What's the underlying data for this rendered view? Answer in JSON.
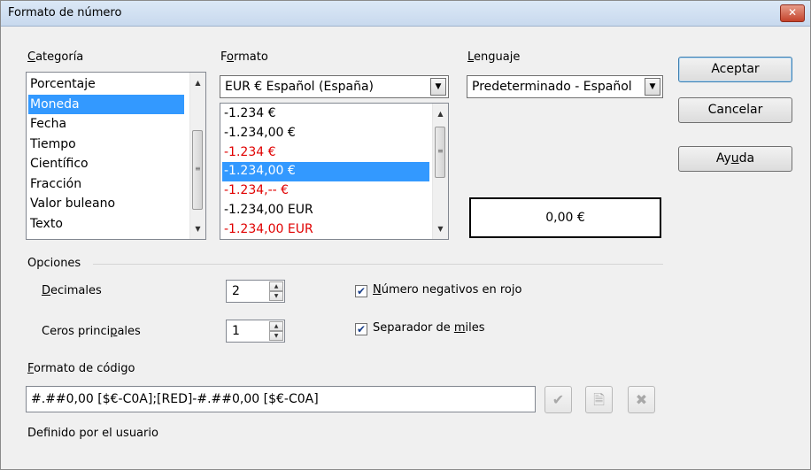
{
  "window": {
    "title": "Formato de número",
    "close_glyph": "✕"
  },
  "categoria": {
    "label_pre": "",
    "label_u": "C",
    "label_post": "ategoría",
    "items": [
      {
        "label": "Porcentaje"
      },
      {
        "label": "Moneda",
        "selected": true
      },
      {
        "label": "Fecha"
      },
      {
        "label": "Tiempo"
      },
      {
        "label": "Científico"
      },
      {
        "label": "Fracción"
      },
      {
        "label": "Valor buleano"
      },
      {
        "label": "Texto"
      }
    ]
  },
  "formato": {
    "label_pre": "F",
    "label_u": "o",
    "label_post": "rmato",
    "combo_value": "EUR € Español (España)",
    "items": [
      {
        "label": "-1.234 €",
        "negative_red": false
      },
      {
        "label": "-1.234,00 €",
        "negative_red": false
      },
      {
        "label": "-1.234 €",
        "negative_red": true
      },
      {
        "label": "-1.234,00 €",
        "negative_red": true,
        "selected": true
      },
      {
        "label": "-1.234,-- €",
        "negative_red": true
      },
      {
        "label": "-1.234,00 EUR",
        "negative_red": false
      },
      {
        "label": "-1.234,00 EUR",
        "negative_red": true
      }
    ]
  },
  "lenguaje": {
    "label_pre": "",
    "label_u": "L",
    "label_post": "enguaje",
    "combo_value": "Predeterminado - Español"
  },
  "preview": {
    "value": "0,00 €"
  },
  "buttons": {
    "ok": "Aceptar",
    "cancel": "Cancelar",
    "help_pre": "Ay",
    "help_u": "u",
    "help_post": "da"
  },
  "opciones": {
    "title": "Opciones",
    "decimales": {
      "label_pre": "",
      "label_u": "D",
      "label_post": "ecimales",
      "value": "2"
    },
    "ceros": {
      "label_pre": "Ceros princi",
      "label_u": "p",
      "label_post": "ales",
      "value": "1"
    },
    "negativos": {
      "label_pre": "",
      "label_u": "N",
      "label_post": "úmero negativos en rojo",
      "checked": true
    },
    "separador": {
      "label_pre": "Separador de ",
      "label_u": "m",
      "label_post": "iles",
      "checked": true
    }
  },
  "codigo": {
    "label_pre": "",
    "label_u": "F",
    "label_post": "ormato de código",
    "value": "#.##0,00 [$€-C0A];[RED]-#.##0,00 [$€-C0A]",
    "status": "Definido por el usuario"
  },
  "icons": {
    "check": "check-icon",
    "comment": "comment-icon",
    "delete": "delete-icon"
  },
  "colors": {
    "selection": "#3399ff",
    "negative_red": "#e00000"
  }
}
